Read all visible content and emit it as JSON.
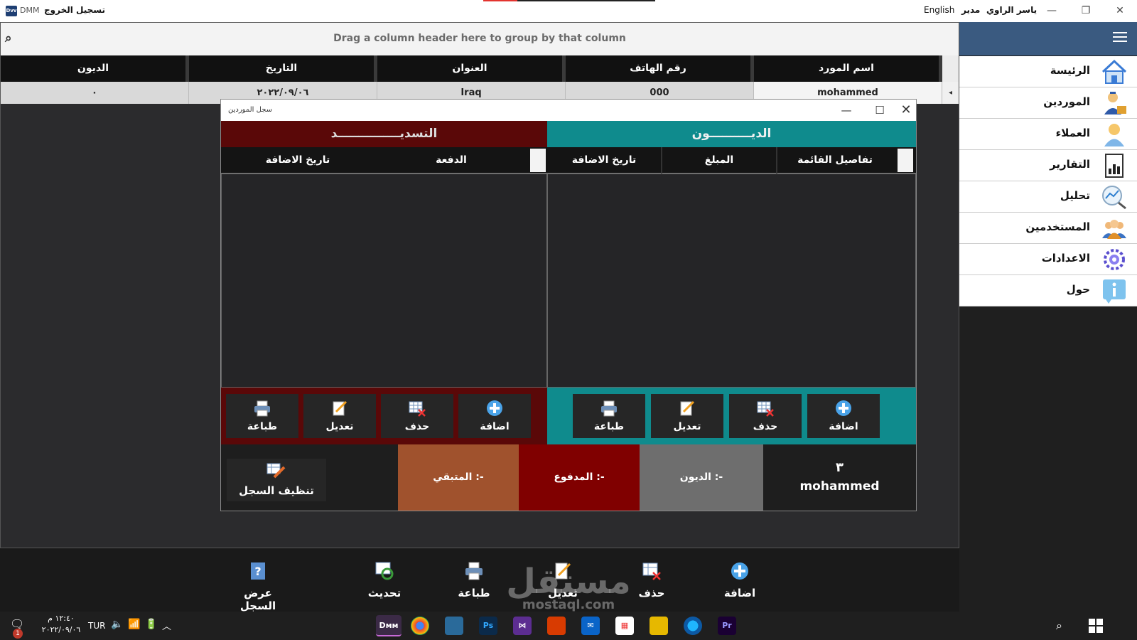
{
  "window": {
    "app_short": "DMM",
    "logout_label": "تسجيل الخروج",
    "language_label": "English",
    "role_label": "مدير",
    "user_name": "ياسر الراوي"
  },
  "grid": {
    "group_hint": "Drag a column header here to group by that column",
    "columns": [
      "الديون",
      "التاريخ",
      "العنوان",
      "رقم الهاتف",
      "اسم المورد"
    ],
    "row": {
      "debt": "٠",
      "date": "٢٠٢٢/٠٩/٠٦",
      "address": "Iraq",
      "phone": "000",
      "supplier": "mohammed"
    }
  },
  "sidebar": {
    "items": [
      {
        "label": "الرئيسة",
        "icon": "home-icon"
      },
      {
        "label": "الموردين",
        "icon": "supplier-icon"
      },
      {
        "label": "العملاء",
        "icon": "customer-icon"
      },
      {
        "label": "التقارير",
        "icon": "reports-icon"
      },
      {
        "label": "تحليل",
        "icon": "analysis-icon"
      },
      {
        "label": "المستخدمين",
        "icon": "users-icon"
      },
      {
        "label": "الاعدادات",
        "icon": "settings-icon"
      },
      {
        "label": "حول",
        "icon": "info-icon"
      }
    ]
  },
  "dialog": {
    "title": "سجل الموردين",
    "payment_header": "التسديـــــــــــــــد",
    "debt_header": "الديــــــــــون",
    "payment_columns": [
      "تاريخ الاضافة",
      "الدفعة"
    ],
    "debt_columns": [
      "تاريخ الاضافة",
      "المبلغ",
      "تفاصيل القائمة"
    ],
    "buttons": {
      "print": "طباعة",
      "edit": "تعديل",
      "delete": "حذف",
      "add": "اضافة"
    },
    "clean_label": "تنظيف السجل",
    "remaining_label": "المتبقي :-",
    "paid_label": "المدفوع :-",
    "debts_label": "الديون :-",
    "supplier_number": "٣",
    "supplier_name": "mohammed"
  },
  "toolbar": {
    "view_log": "عرض السجل",
    "refresh": "تحديث",
    "print": "طباعة",
    "edit": "تعديل",
    "delete": "حذف",
    "add": "اضافة"
  },
  "taskbar": {
    "time": "١٢:٤٠ م",
    "date": "٢٠٢٢/٠٩/٠٦",
    "lang": "TUR",
    "notif_count": "1"
  },
  "watermark": {
    "ar": "مستقل",
    "en": "mostaql.com"
  },
  "colors": {
    "teal": "#0f8b8d",
    "maroon": "#5a0808",
    "remaining": "#a0522d",
    "paid": "#800000",
    "debt": "#6e6e6e",
    "nav_accent": "#3a5a80"
  }
}
